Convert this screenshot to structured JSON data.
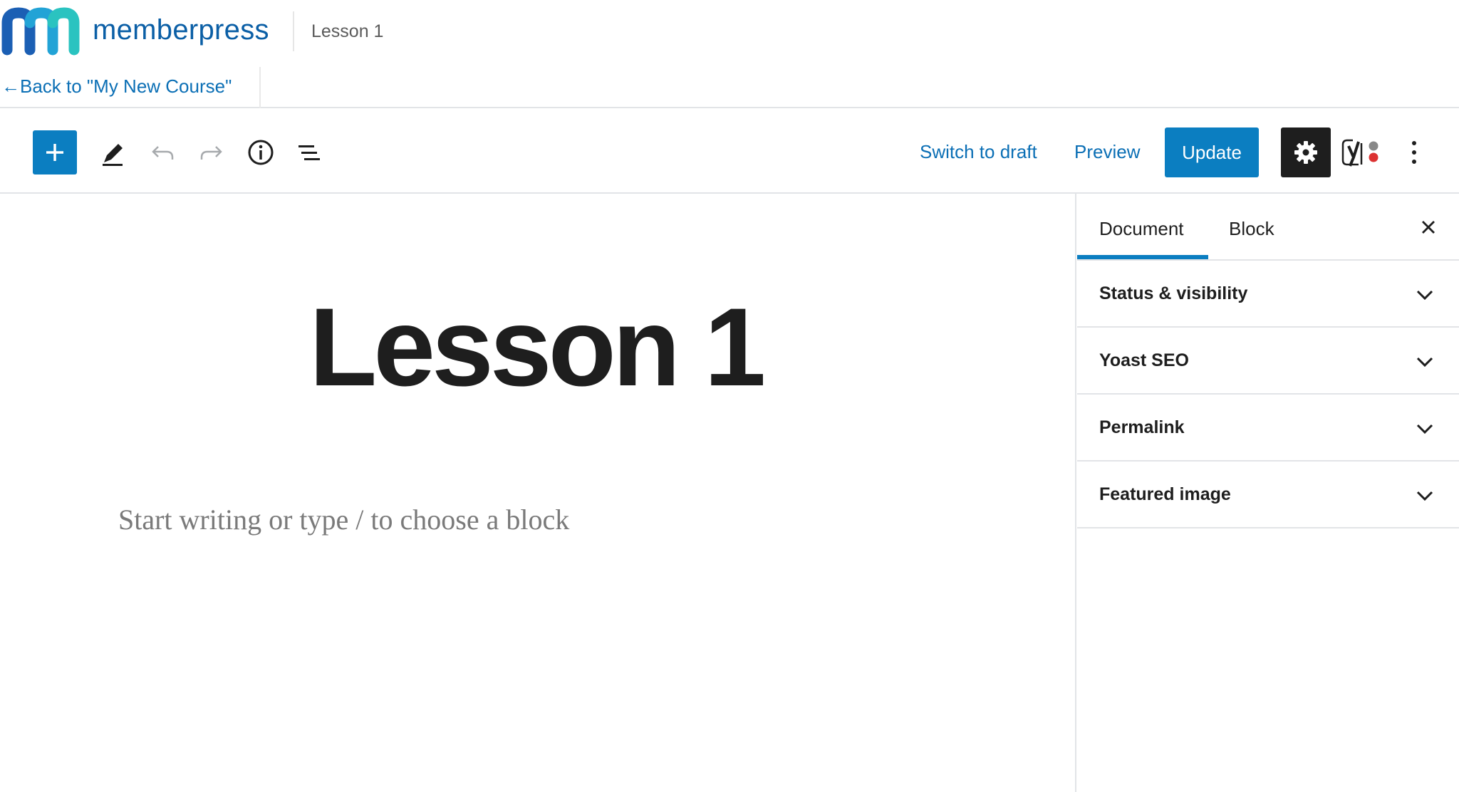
{
  "header": {
    "brand": "memberpress",
    "page_title": "Lesson 1",
    "back_link": "←Back to \"My New Course\""
  },
  "toolbar": {
    "icons": [
      "plus-icon",
      "pencil-icon",
      "undo-icon",
      "redo-icon",
      "info-icon",
      "list-view-icon",
      "gear-icon",
      "yoast-icon",
      "more-vertical-icon"
    ],
    "switch_to_draft": "Switch to draft",
    "preview": "Preview",
    "update": "Update"
  },
  "editor": {
    "title": "Lesson 1",
    "placeholder": "Start writing or type / to choose a block"
  },
  "sidebar": {
    "tabs": [
      {
        "label": "Document",
        "active": true
      },
      {
        "label": "Block",
        "active": false
      }
    ],
    "panels": [
      {
        "label": "Status & visibility"
      },
      {
        "label": "Yoast SEO"
      },
      {
        "label": "Permalink"
      },
      {
        "label": "Featured image"
      }
    ]
  },
  "colors": {
    "accent": "#0b7ec1",
    "link": "#0b6fb5",
    "brand_text": "#0b5fa6",
    "dark": "#1e1e1e",
    "yoast_red": "#dc3232"
  }
}
